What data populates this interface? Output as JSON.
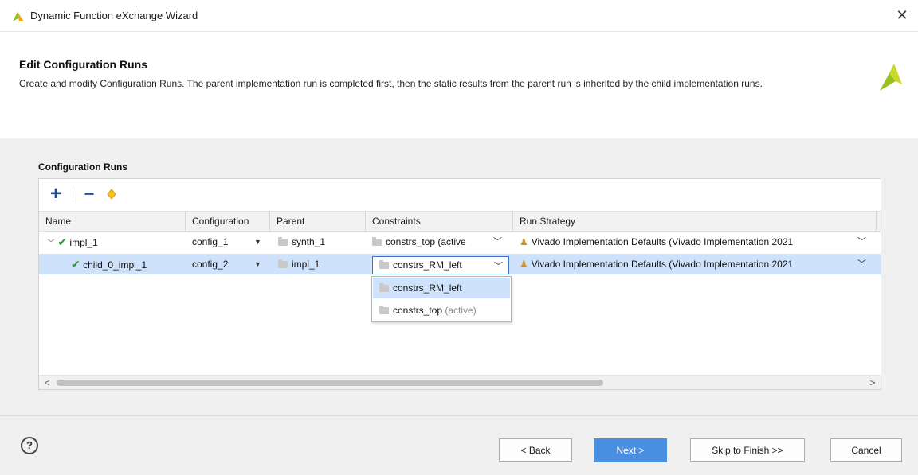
{
  "window": {
    "title": "Dynamic Function eXchange Wizard",
    "close_glyph": "✕"
  },
  "header": {
    "heading": "Edit Configuration Runs",
    "description": "Create and modify Configuration Runs. The parent implementation run is completed first, then the static results from the parent run is inherited by the child implementation runs."
  },
  "section_label": "Configuration Runs",
  "toolbar": {
    "add_icon": "plus-icon",
    "remove_icon": "minus-icon",
    "diamond_icon": "diamond-icon"
  },
  "columns": [
    "Name",
    "Configuration",
    "Parent",
    "Constraints",
    "Run Strategy"
  ],
  "rows": [
    {
      "name": "impl_1",
      "configuration": "config_1",
      "parent": "synth_1",
      "constraints": "constrs_top (active",
      "run_strategy": "Vivado Implementation Defaults (Vivado Implementation 2021"
    },
    {
      "name": "child_0_impl_1",
      "configuration": "config_2",
      "parent": "impl_1",
      "constraints": "constrs_RM_left",
      "run_strategy": "Vivado Implementation Defaults (Vivado Implementation 2021"
    }
  ],
  "dropdown": {
    "options": [
      {
        "label": "constrs_RM_left",
        "suffix": ""
      },
      {
        "label": "constrs_top",
        "suffix": "(active)"
      }
    ]
  },
  "footer": {
    "back_label": "< Back",
    "next_label": "Next >",
    "skip_label": "Skip to Finish >>",
    "cancel_label": "Cancel",
    "help_glyph": "?"
  },
  "colors": {
    "accent": "#4a90e2",
    "selection": "#cfe2fb",
    "check": "#2e9a2e",
    "logo": "#c8d92a",
    "toolbar_icon": "#1f4e9a"
  }
}
